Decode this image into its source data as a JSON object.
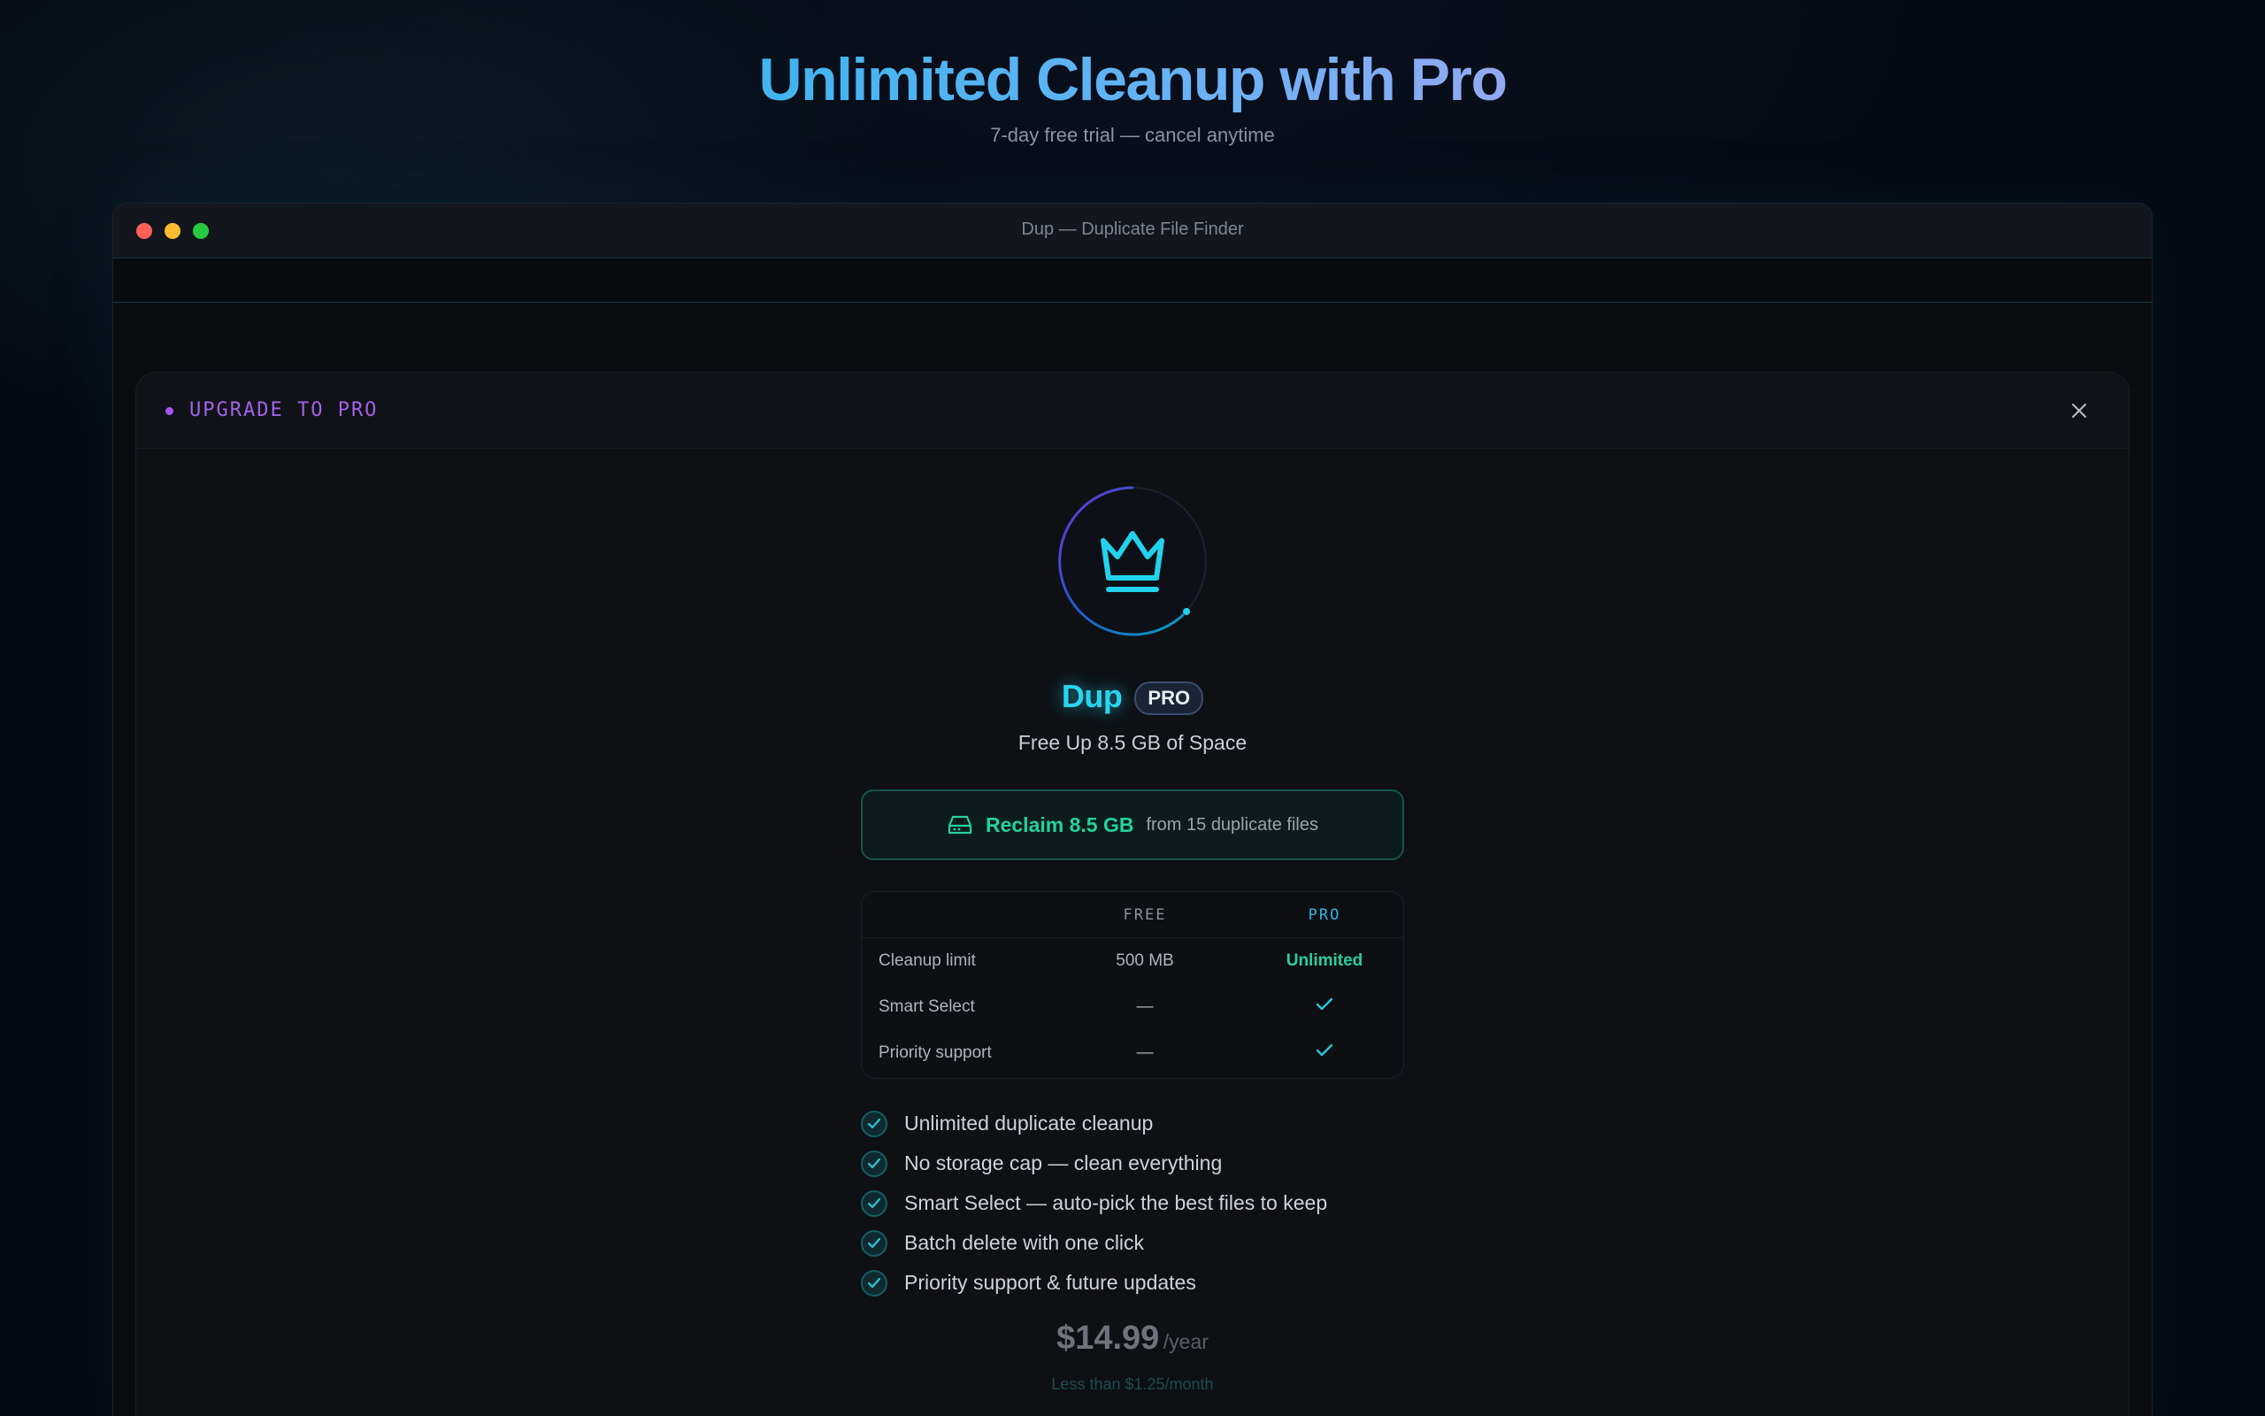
{
  "hero": {
    "title": "Unlimited Cleanup with Pro",
    "subtitle": "7-day free trial — cancel anytime"
  },
  "window": {
    "title": "Dup — Duplicate File Finder"
  },
  "modal": {
    "label": "UPGRADE TO PRO",
    "app_name": "Dup",
    "badge": "PRO",
    "tagline": "Free Up 8.5 GB of Space",
    "reclaim": {
      "main": "Reclaim 8.5 GB",
      "sub": "from 15 duplicate files"
    },
    "compare": {
      "headers": [
        "",
        "FREE",
        "PRO"
      ],
      "rows": [
        {
          "label": "Cleanup limit",
          "free": "500 MB",
          "pro": "Unlimited"
        },
        {
          "label": "Smart Select",
          "free": "—",
          "pro": "check-icon"
        },
        {
          "label": "Priority support",
          "free": "—",
          "pro": "check-icon"
        }
      ]
    },
    "features": [
      "Unlimited duplicate cleanup",
      "No storage cap — clean everything",
      "Smart Select — auto-pick the best files to keep",
      "Batch delete with one click",
      "Priority support & future updates"
    ],
    "price": {
      "amount": "$14.99",
      "period": "/year",
      "note": "Less than $1.25/month"
    }
  },
  "colors": {
    "accent_cyan": "#22d3ee",
    "accent_green": "#23d29a",
    "accent_purple": "#a855f7"
  }
}
